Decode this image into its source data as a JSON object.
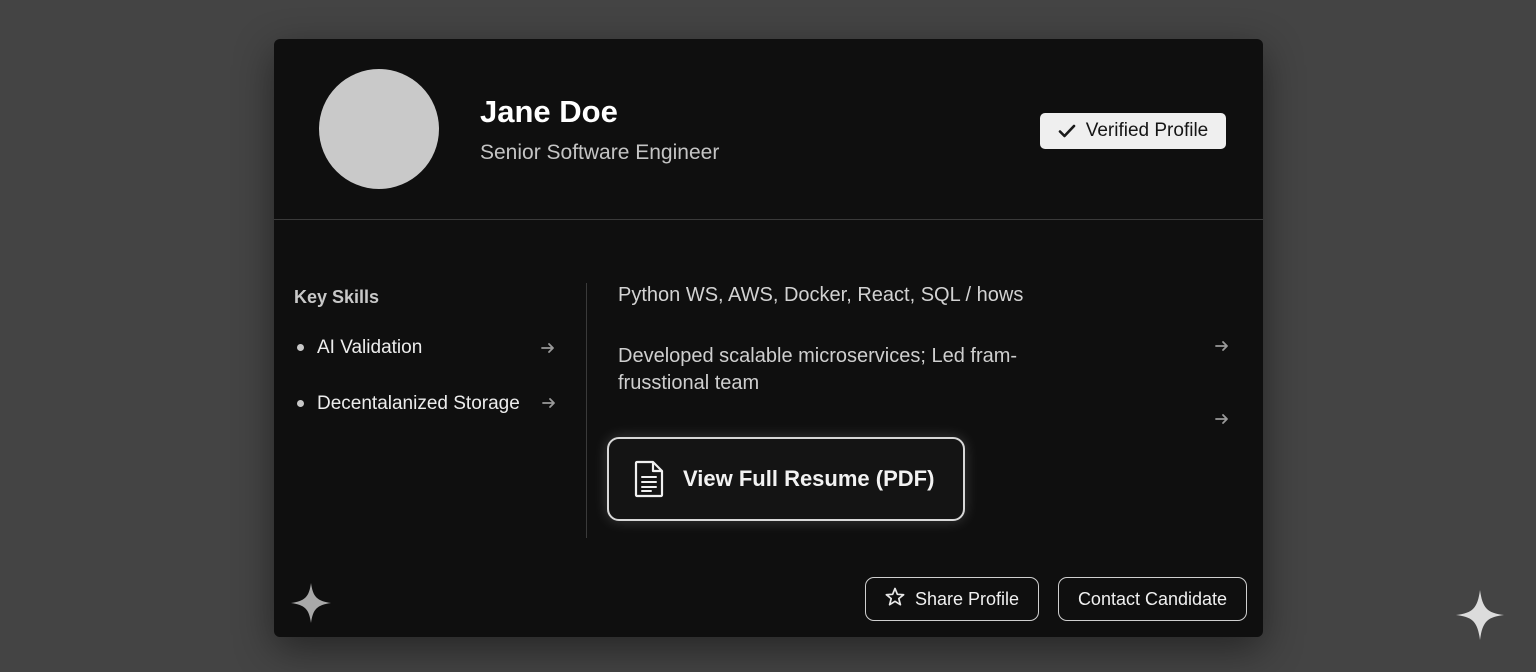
{
  "profile": {
    "name": "Jane Doe",
    "title": "Senior Software Engineer",
    "verified_label": "Verified Profile"
  },
  "skills": {
    "heading": "Key Skills",
    "items": [
      {
        "label": "AI Validation"
      },
      {
        "label": "Decentalanized Storage"
      }
    ]
  },
  "details": {
    "tech": "Python WS, AWS, Docker, React, SQL / hows",
    "description": "Developed scalable microservices; Led fram-frusstional team"
  },
  "actions": {
    "resume_label": "View Full Resume (PDF)",
    "share_label": "Share Profile",
    "contact_label": "Contact Candidate"
  },
  "icons": {
    "verified": "check-icon",
    "resume": "document-icon",
    "share": "star-icon",
    "arrows": "arrow-right-icon",
    "decor": "sparkle-icon"
  },
  "colors": {
    "page_background": "#444444",
    "card_background": "#0f0f0f",
    "badge_background": "#efefef",
    "avatar": "#c9c9c9"
  }
}
